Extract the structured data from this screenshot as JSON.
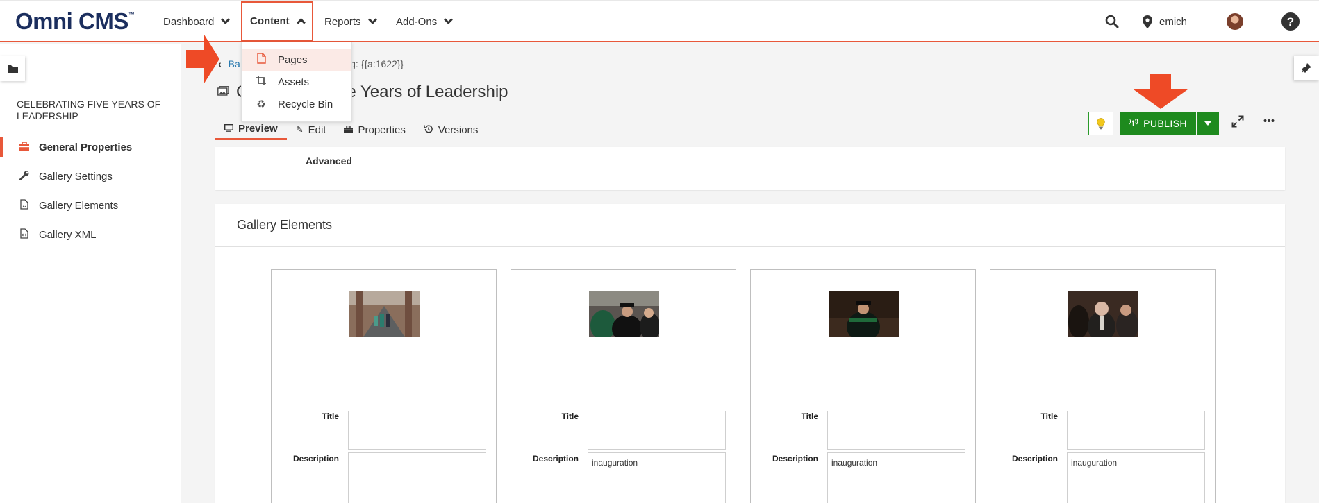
{
  "app": {
    "logo": "Omni CMS",
    "logo_tm": "™"
  },
  "nav": {
    "dashboard": "Dashboard",
    "content": "Content",
    "reports": "Reports",
    "addons": "Add-Ons",
    "user": "emich"
  },
  "content_menu": {
    "items": [
      {
        "label": "Pages",
        "icon": "page-icon"
      },
      {
        "label": "Assets",
        "icon": "crop-icon"
      },
      {
        "label": "Recycle Bin",
        "icon": "recycle-icon"
      }
    ]
  },
  "sidebar": {
    "title": "CELEBRATING FIVE YEARS OF LEADERSHIP",
    "items": [
      {
        "label": "General Properties",
        "icon": "toolbox-icon",
        "active": true
      },
      {
        "label": "Gallery Settings",
        "icon": "wrench-icon"
      },
      {
        "label": "Gallery Elements",
        "icon": "file-image-icon"
      },
      {
        "label": "Gallery XML",
        "icon": "file-code-icon"
      }
    ]
  },
  "breadcrumb": {
    "back_visible": "Ba",
    "tag_visible": "cy Tag: {{a:1622}}"
  },
  "page": {
    "title_first_letter": "C",
    "title_visible": "e Years of Leadership"
  },
  "tabs": [
    {
      "label": "Preview",
      "icon": "monitor-icon",
      "active": true
    },
    {
      "label": "Edit",
      "icon": "pencil-icon"
    },
    {
      "label": "Properties",
      "icon": "toolbox-icon"
    },
    {
      "label": "Versions",
      "icon": "history-icon"
    }
  ],
  "toolbar": {
    "publish_label": "PUBLISH"
  },
  "top_card": {
    "advanced_label": "Advanced"
  },
  "gallery": {
    "heading": "Gallery Elements",
    "title_label": "Title",
    "description_label": "Description",
    "elements": [
      {
        "title": "",
        "description": "",
        "photo": "bridge-walk"
      },
      {
        "title": "",
        "description": "inauguration",
        "photo": "regalia-procession"
      },
      {
        "title": "",
        "description": "inauguration",
        "photo": "seated-speaker"
      },
      {
        "title": "",
        "description": "inauguration",
        "photo": "reception"
      }
    ]
  },
  "colors": {
    "accent": "#e8583a",
    "publish": "#1e8a1e",
    "logo": "#1b2e5e"
  }
}
